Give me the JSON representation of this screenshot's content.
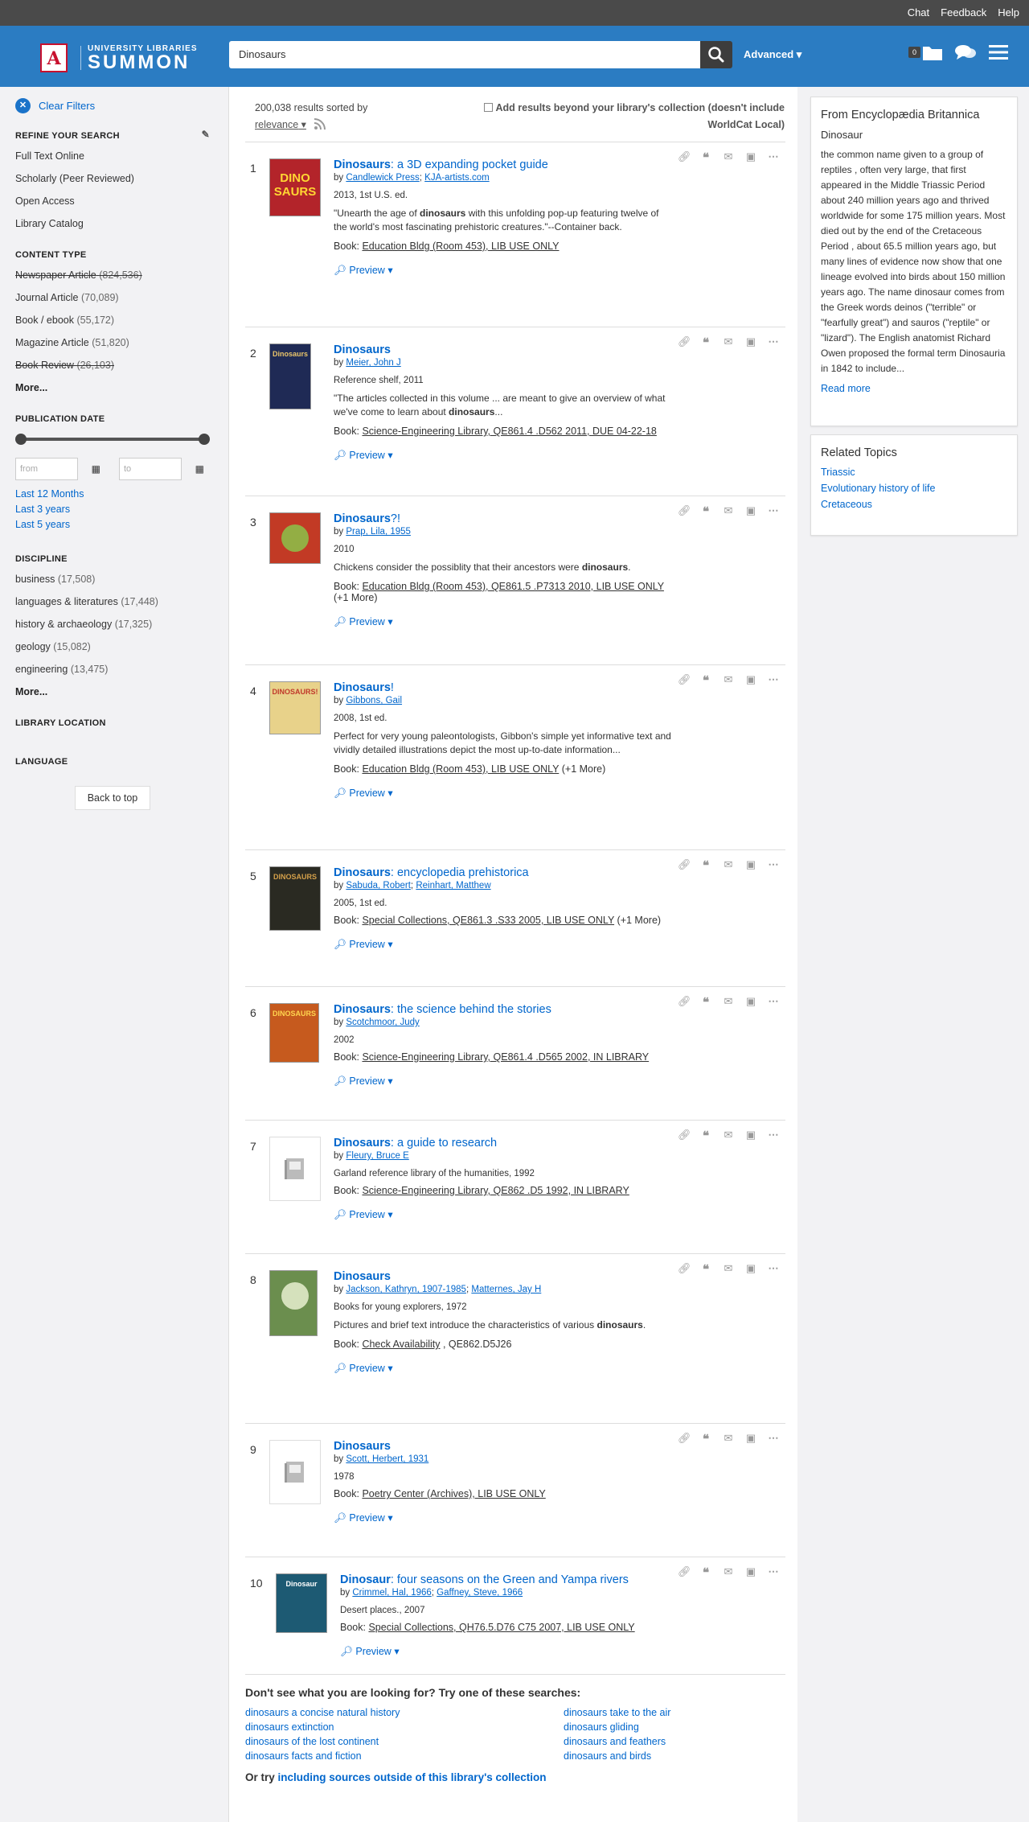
{
  "topbar": {
    "chat": "Chat",
    "feedback": "Feedback",
    "help": "Help"
  },
  "header": {
    "logo_line1": "UNIVERSITY LIBRARIES",
    "logo_line2": "SUMMON",
    "logo_mark": "A",
    "search_value": "Dinosaurs",
    "advanced": "Advanced",
    "folder_count": "0",
    "brand_color": "#2b7cc2"
  },
  "sidebar": {
    "clear_filters": "Clear Filters",
    "refine_title": "REFINE YOUR SEARCH",
    "refine_items": [
      "Full Text Online",
      "Scholarly (Peer Reviewed)",
      "Open Access",
      "Library Catalog"
    ],
    "content_type_title": "CONTENT TYPE",
    "content_types": [
      {
        "label": "Newspaper Article",
        "count": "(824,536)"
      },
      {
        "label": "Journal Article",
        "count": "(70,089)"
      },
      {
        "label": "Book / ebook",
        "count": "(55,172)"
      },
      {
        "label": "Magazine Article",
        "count": "(51,820)"
      },
      {
        "label": "Book Review",
        "count": "(26,103)"
      }
    ],
    "more": "More...",
    "pubdate_title": "PUBLICATION DATE",
    "from_placeholder": "from",
    "to_placeholder": "to",
    "date_links": [
      "Last 12 Months",
      "Last 3 years",
      "Last 5 years"
    ],
    "discipline_title": "DISCIPLINE",
    "disciplines": [
      {
        "label": "business",
        "count": "(17,508)"
      },
      {
        "label": "languages & literatures",
        "count": "(17,448)"
      },
      {
        "label": "history & archaeology",
        "count": "(17,325)"
      },
      {
        "label": "geology",
        "count": "(15,082)"
      },
      {
        "label": "engineering",
        "count": "(13,475)"
      }
    ],
    "location_title": "LIBRARY LOCATION",
    "language_title": "LANGUAGE",
    "back_to_top": "Back to top"
  },
  "results_header": {
    "count_text": "200,038 results sorted by",
    "sort": "relevance",
    "beyond": "Add results beyond your library's collection (doesn't include WorldCat Local)"
  },
  "results": [
    {
      "num": "1",
      "title_bold": "Dinosaurs",
      "title_rest": ": a 3D expanding pocket guide",
      "by": "by",
      "authors": [
        "Candlewick Press",
        "KJA-artists.com"
      ],
      "pub": "2013, 1st U.S. ed.",
      "desc_pre": "\"Unearth the age of ",
      "desc_bold": "dinosaurs",
      "desc_post": " with this unfolding pop-up featuring twelve of the world's most fascinating prehistoric creatures.\"--Container back.",
      "book_label": "Book:",
      "book_loc": "Education Bldg (Room 453), LIB USE ONLY",
      "book_extra": "",
      "preview": "Preview"
    },
    {
      "num": "2",
      "title_bold": "Dinosaurs",
      "title_rest": "",
      "by": "by",
      "authors": [
        "Meier, John J"
      ],
      "pub": "Reference shelf, 2011",
      "desc_pre": "\"The articles collected in this volume ... are meant to give an overview of what we've come to learn about ",
      "desc_bold": "dinosaurs",
      "desc_post": "...",
      "book_label": "Book:",
      "book_loc": "Science-Engineering Library, QE861.4 .D562 2011, DUE 04-22-18",
      "book_extra": "",
      "preview": "Preview"
    },
    {
      "num": "3",
      "title_bold": "Dinosaurs",
      "title_rest": "?!",
      "by": "by",
      "authors": [
        "Prap, Lila, 1955"
      ],
      "pub": "2010",
      "desc_pre": "Chickens consider the possiblity that their ancestors were ",
      "desc_bold": "dinosaurs",
      "desc_post": ".",
      "book_label": "Book:",
      "book_loc": "Education Bldg (Room 453), QE861.5 .P7313 2010, LIB USE ONLY",
      "book_extra": "(+1 More)",
      "preview": "Preview"
    },
    {
      "num": "4",
      "title_bold": "Dinosaurs",
      "title_rest": "!",
      "by": "by",
      "authors": [
        "Gibbons, Gail"
      ],
      "pub": "2008, 1st ed.",
      "desc_pre": "Perfect for very young paleontologists, Gibbon's simple yet informative text and vividly detailed illustrations depict the most up-to-date information...",
      "desc_bold": "",
      "desc_post": "",
      "book_label": "Book:",
      "book_loc": "Education Bldg (Room 453), LIB USE ONLY",
      "book_extra": "(+1 More)",
      "preview": "Preview"
    },
    {
      "num": "5",
      "title_bold": "Dinosaurs",
      "title_rest": ": encyclopedia prehistorica",
      "by": "by",
      "authors": [
        "Sabuda, Robert",
        "Reinhart, Matthew"
      ],
      "pub": "2005, 1st ed.",
      "desc_pre": "",
      "desc_bold": "",
      "desc_post": "",
      "book_label": "Book:",
      "book_loc": "Special Collections, QE861.3 .S33 2005, LIB USE ONLY",
      "book_extra": "(+1 More)",
      "preview": "Preview"
    },
    {
      "num": "6",
      "title_bold": "Dinosaurs",
      "title_rest": ": the science behind the stories",
      "by": "by",
      "authors": [
        "Scotchmoor, Judy"
      ],
      "pub": "2002",
      "desc_pre": "",
      "desc_bold": "",
      "desc_post": "",
      "book_label": "Book:",
      "book_loc": "Science-Engineering Library, QE861.4 .D565 2002, IN LIBRARY",
      "book_extra": "",
      "preview": "Preview"
    },
    {
      "num": "7",
      "title_bold": "Dinosaurs",
      "title_rest": ": a guide to research",
      "by": "by",
      "authors": [
        "Fleury, Bruce E"
      ],
      "pub": "Garland reference library of the humanities, 1992",
      "desc_pre": "",
      "desc_bold": "",
      "desc_post": "",
      "book_label": "Book:",
      "book_loc": "Science-Engineering Library, QE862 .D5 1992, IN LIBRARY",
      "book_extra": "",
      "preview": "Preview"
    },
    {
      "num": "8",
      "title_bold": "Dinosaurs",
      "title_rest": "",
      "by": "by",
      "authors": [
        "Jackson, Kathryn, 1907-1985",
        "Matternes, Jay H"
      ],
      "pub": "Books for young explorers, 1972",
      "desc_pre": "Pictures and brief text introduce the characteristics of various ",
      "desc_bold": "dinosaurs",
      "desc_post": ".",
      "book_label": "Book:",
      "book_loc": "Check Availability",
      "book_extra": ", QE862.D5J26",
      "preview": "Preview"
    },
    {
      "num": "9",
      "title_bold": "Dinosaurs",
      "title_rest": "",
      "by": "by",
      "authors": [
        "Scott, Herbert, 1931"
      ],
      "pub": "1978",
      "desc_pre": "",
      "desc_bold": "",
      "desc_post": "",
      "book_label": "Book:",
      "book_loc": "Poetry Center (Archives), LIB USE ONLY",
      "book_extra": "",
      "preview": "Preview"
    },
    {
      "num": "10",
      "title_bold": "Dinosaur",
      "title_rest": ": four seasons on the Green and Yampa rivers",
      "by": "by",
      "authors": [
        "Crimmel, Hal, 1966",
        "Gaffney, Steve, 1966"
      ],
      "pub": "Desert places., 2007",
      "desc_pre": "",
      "desc_bold": "",
      "desc_post": "",
      "book_label": "Book:",
      "book_loc": "Special Collections, QH76.5.D76 C75 2007, LIB USE ONLY",
      "book_extra": "",
      "preview": "Preview"
    }
  ],
  "thumb_texts": {
    "t1": "DINO SAURS",
    "t2": "Dinosaurs",
    "t4": "DINOSAURS!",
    "t5": "DINOSAURS",
    "t6": "DINOSAURS",
    "t10": "Dinosaur"
  },
  "suggestions": {
    "title": "Don't see what you are looking for? Try one of these searches:",
    "left": [
      "dinosaurs a concise natural history",
      "dinosaurs extinction",
      "dinosaurs of the lost continent",
      "dinosaurs facts and fiction"
    ],
    "right": [
      "dinosaurs take to the air",
      "dinosaurs gliding",
      "dinosaurs and feathers",
      "dinosaurs and birds"
    ],
    "or_try": "Or try",
    "or_try_link": "including sources outside of this library's collection"
  },
  "encyclopedia": {
    "heading": "From Encyclopædia Britannica",
    "subject": "Dinosaur",
    "text": "the common name given to a group of reptiles , often very large, that first appeared in the Middle Triassic Period about 240 million years ago and thrived worldwide for some 175 million years. Most died out by the end of the Cretaceous Period , about 65.5 million years ago, but many lines of evidence now show that one lineage evolved into birds about 150 million years ago. The name dinosaur comes from the Greek words deinos (\"terrible\" or \"fearfully great\") and sauros (\"reptile\" or \"lizard\"). The English anatomist Richard Owen proposed the formal term Dinosauria in 1842 to include...",
    "read_more": "Read more"
  },
  "related": {
    "heading": "Related Topics",
    "topics": [
      "Triassic",
      "Evolutionary history of life",
      "Cretaceous"
    ]
  }
}
